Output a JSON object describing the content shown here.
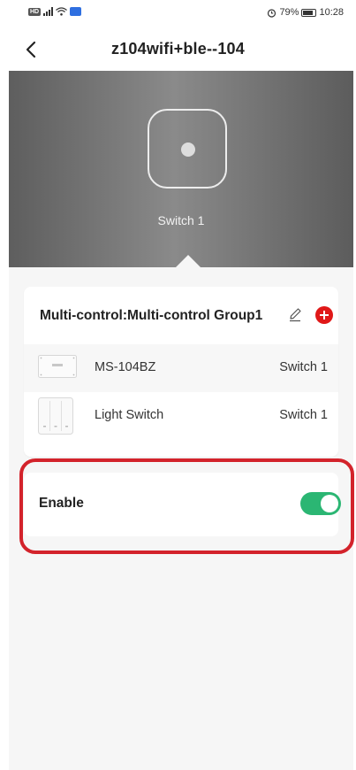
{
  "status_bar": {
    "hd_label": "HD",
    "battery_percent": "79%",
    "time": "10:28"
  },
  "nav": {
    "title": "z104wifi+ble--104"
  },
  "hero": {
    "switch_label": "Switch 1"
  },
  "group": {
    "title": "Multi-control:Multi-control Group1",
    "devices": [
      {
        "name": "MS-104BZ",
        "channel": "Switch 1"
      },
      {
        "name": "Light Switch",
        "channel": "Switch 1"
      }
    ]
  },
  "enable": {
    "label": "Enable",
    "on": true
  },
  "colors": {
    "toggle_on": "#2bb673",
    "add_button": "#e01818",
    "highlight": "#d3232b"
  }
}
